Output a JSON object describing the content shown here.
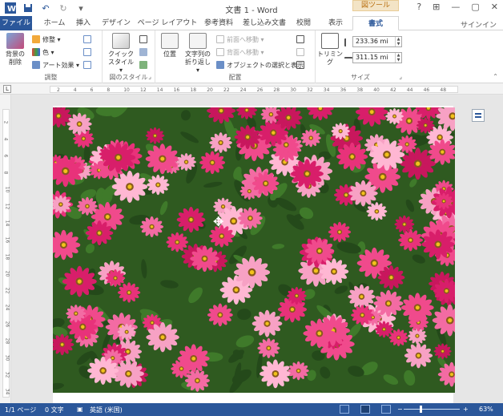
{
  "window": {
    "title": "文書 1 - Word",
    "help_icon": "?",
    "minimize_icon": "—",
    "restore_icon": "▢",
    "close_icon": "✕",
    "ribbon_display_icon": "⊞"
  },
  "qat": {
    "undo_icon": "↶",
    "redo_icon": "↻",
    "customize_icon": "▾"
  },
  "tabs": {
    "file": "ファイル",
    "home": "ホーム",
    "insert": "挿入",
    "design": "デザイン",
    "layout": "ページ レイアウト",
    "references": "参考資料",
    "mailings": "差し込み文書",
    "review": "校閲",
    "view": "表示",
    "contextual_group": "図ツール",
    "format": "書式",
    "signin": "サインイン"
  },
  "ribbon": {
    "remove_bg": {
      "line1": "背景の",
      "line2": "削除"
    },
    "corrections": "修整 ▾",
    "color": "色 ▾",
    "art_effects": "アート効果 ▾",
    "adjust_label": "調整",
    "quick_styles": {
      "line1": "クイック",
      "line2": "スタイル ▾"
    },
    "styles_label": "図のスタイル",
    "position": "位置",
    "wrap_text": {
      "line1": "文字列の",
      "line2": "折り返し ▾"
    },
    "bring_forward": "前面へ移動 ▾",
    "send_backward": "背面へ移動 ▾",
    "selection_pane": "オブジェクトの選択と表示",
    "arrange_label": "配置",
    "crop": "トリミング",
    "height_value": "233.36 mi",
    "width_value": "311.15 mi",
    "size_label": "サイズ"
  },
  "ruler": {
    "tab_selector": "L",
    "h_ticks": [
      "2",
      "4",
      "6",
      "8",
      "10",
      "12",
      "14",
      "16",
      "18",
      "20",
      "22",
      "24",
      "26",
      "28",
      "30",
      "32",
      "34",
      "36",
      "38",
      "40",
      "42",
      "44",
      "46",
      "48"
    ],
    "v_ticks": [
      "2",
      "4",
      "6",
      "8",
      "10",
      "12",
      "14",
      "16",
      "18",
      "20",
      "22",
      "24",
      "26",
      "28",
      "30",
      "32",
      "34"
    ]
  },
  "status": {
    "page": "1/1 ページ",
    "words": "0 文字",
    "language": "英語 (米国)",
    "zoom_minus": "−",
    "zoom_plus": "+",
    "zoom": "63%"
  },
  "colors": {
    "word_blue": "#2b579a",
    "tools_tab": "#f3e4c6",
    "zinnia_pink": "#e8327a",
    "leaf_green": "#2e5a1f"
  }
}
